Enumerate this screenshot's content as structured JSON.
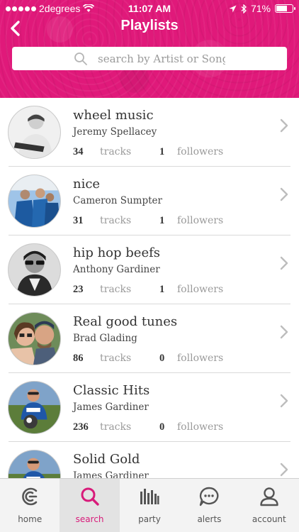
{
  "status_bar": {
    "carrier": "2degrees",
    "time": "11:07 AM",
    "battery_percent": "71%",
    "battery_level": 0.71
  },
  "header": {
    "title": "Playlists",
    "back_icon": "chevron-left-icon",
    "accent_color": "#e0197a"
  },
  "search": {
    "placeholder": "search by Artist or Song",
    "value": ""
  },
  "playlists": [
    {
      "title": "wheel music",
      "owner": "Jeremy Spellacey",
      "tracks": "34",
      "followers": "1"
    },
    {
      "title": "nice",
      "owner": "Cameron Sumpter",
      "tracks": "31",
      "followers": "1"
    },
    {
      "title": "hip hop beefs",
      "owner": "Anthony Gardiner",
      "tracks": "23",
      "followers": "1"
    },
    {
      "title": "Real good tunes",
      "owner": "Brad Glading",
      "tracks": "86",
      "followers": "0"
    },
    {
      "title": "Classic Hits",
      "owner": "James Gardiner",
      "tracks": "236",
      "followers": "0"
    },
    {
      "title": "Solid Gold",
      "owner": "James Gardiner",
      "tracks": "",
      "followers": ""
    }
  ],
  "labels": {
    "tracks": "tracks",
    "followers": "followers"
  },
  "tabs": [
    {
      "label": "home",
      "icon": "home-icon",
      "active": false
    },
    {
      "label": "search",
      "icon": "search-icon",
      "active": true
    },
    {
      "label": "party",
      "icon": "party-icon",
      "active": false
    },
    {
      "label": "alerts",
      "icon": "alerts-icon",
      "active": false
    },
    {
      "label": "account",
      "icon": "account-icon",
      "active": false
    }
  ]
}
